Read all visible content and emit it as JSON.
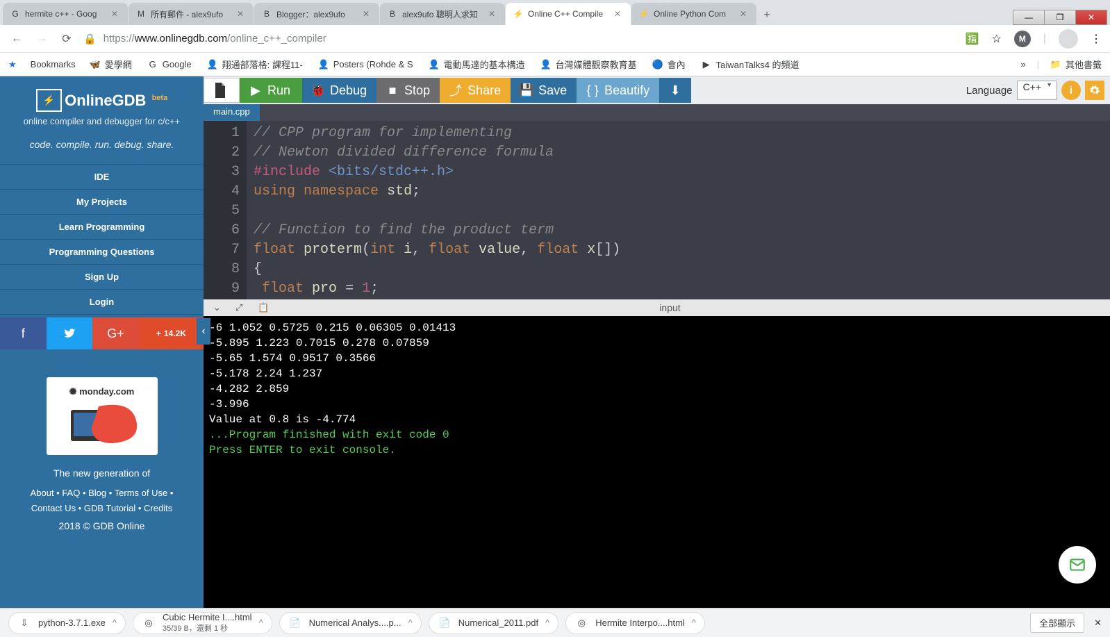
{
  "window_controls": {
    "min": "—",
    "max": "❐",
    "close": "✕"
  },
  "tabs": [
    {
      "title": "hermite c++ - Goog",
      "favicon": "G"
    },
    {
      "title": "所有郵件 - alex9ufo",
      "favicon": "M"
    },
    {
      "title": "Blogger：alex9ufo",
      "favicon": "B"
    },
    {
      "title": "alex9ufo 聰明人求知",
      "favicon": "B"
    },
    {
      "title": "Online C++ Compile",
      "favicon": "⚡",
      "active": true
    },
    {
      "title": "Online Python Com",
      "favicon": "⚡"
    }
  ],
  "new_tab": "+",
  "nav": {
    "back": "←",
    "fwd": "→",
    "reload": "⟳",
    "lock": "🔒",
    "url_secure": "https://",
    "url_host": "www.onlinegdb.com",
    "url_path": "/online_c++_compiler",
    "translate": "⦿",
    "star": "☆",
    "menu": "⋮",
    "ext": "M"
  },
  "bookmarks": {
    "star": "★",
    "label": "Bookmarks",
    "items": [
      {
        "icon": "🦋",
        "text": "愛學網"
      },
      {
        "icon": "G",
        "text": "Google"
      },
      {
        "icon": "👤",
        "text": "翔通部落格: 課程11-"
      },
      {
        "icon": "👤",
        "text": "Posters (Rohde & S"
      },
      {
        "icon": "👤",
        "text": "電動馬達的基本構造"
      },
      {
        "icon": "👤",
        "text": "台灣媒體觀察教育基"
      },
      {
        "icon": "🔵",
        "text": "會內"
      },
      {
        "icon": "▶",
        "text": "TaiwanTalks4 的頻道"
      }
    ],
    "overflow": "»",
    "folder": "其他書籤"
  },
  "sidebar": {
    "logo_glyph": "⚡",
    "brand": "OnlineGDB",
    "beta": "beta",
    "subtitle": "online compiler and debugger for c/c++",
    "tagline": "code. compile. run. debug. share.",
    "nav": [
      "IDE",
      "My Projects",
      "Learn Programming",
      "Programming Questions",
      "Sign Up",
      "Login"
    ],
    "social_share": "14.2K",
    "ad_brand": "monday.com",
    "newgen": "The new generation of",
    "footer_line1": "About • FAQ • Blog • Terms of Use •",
    "footer_line2": "Contact Us • GDB Tutorial • Credits",
    "copy": "2018 © GDB Online"
  },
  "toolbar": {
    "run": "Run",
    "debug": "Debug",
    "stop": "Stop",
    "share": "Share",
    "save": "Save",
    "beautify": "Beautify",
    "download": "⬇",
    "lang_label": "Language",
    "lang_value": "C++"
  },
  "filetab": "main.cpp",
  "code": {
    "lines": [
      {
        "n": "1",
        "html": "<span class='cmt'>// CPP program for implementing</span>"
      },
      {
        "n": "2",
        "html": "<span class='cmt'>// Newton divided difference formula</span>"
      },
      {
        "n": "3",
        "html": "<span class='pink'>#include</span> <span class='cyan'>&lt;bits/stdc++.h&gt;</span>"
      },
      {
        "n": "4",
        "html": "<span class='kw'>using</span> <span class='kw'>namespace</span> <span class='ident'>std</span><span class='punc'>;</span>"
      },
      {
        "n": "5",
        "html": ""
      },
      {
        "n": "6",
        "html": "<span class='cmt'>// Function to find the product term</span>"
      },
      {
        "n": "7",
        "html": "<span class='kw'>float</span> <span class='ident'>proterm</span><span class='punc'>(</span><span class='kw'>int</span> <span class='ident'>i</span><span class='punc'>,</span> <span class='kw'>float</span> <span class='ident'>value</span><span class='punc'>,</span> <span class='kw'>float</span> <span class='ident'>x</span><span class='punc'>[])</span>"
      },
      {
        "n": "8",
        "html": "<span class='punc'>{</span>"
      },
      {
        "n": "9",
        "html": " <span class='kw'>float</span> <span class='ident'>pro</span> <span class='punc'>=</span> <span class='num'>1</span><span class='punc'>;</span>"
      }
    ]
  },
  "term_tab": "input",
  "terminal": {
    "l1": "-6       1.052    0.5725   0.215    0.06305             0.01413",
    "l2": "-5.895   1.223    0.7015   0.278    0.07859",
    "l3": "-5.65    1.574    0.9517   0.3566",
    "l4": "-5.178   2.24     1.237",
    "l5": "-4.282   2.859",
    "l6": "-3.996",
    "l7": "",
    "l8": "Value at 0.8 is -4.774",
    "l9": "",
    "g1": "...Program finished with exit code 0",
    "g2": "Press ENTER to exit console."
  },
  "downloads": {
    "items": [
      {
        "icon": "⇩",
        "name": "python-3.7.1.exe",
        "sub": ""
      },
      {
        "icon": "◎",
        "name": "Cubic Hermite I....html",
        "sub": "35/39 B，還剩 1 秒"
      },
      {
        "icon": "📄",
        "name": "Numerical Analys....p..."
      },
      {
        "icon": "📄",
        "name": "Numerical_2011.pdf"
      },
      {
        "icon": "◎",
        "name": "Hermite Interpo....html"
      }
    ],
    "showall": "全部顯示",
    "close": "✕"
  }
}
